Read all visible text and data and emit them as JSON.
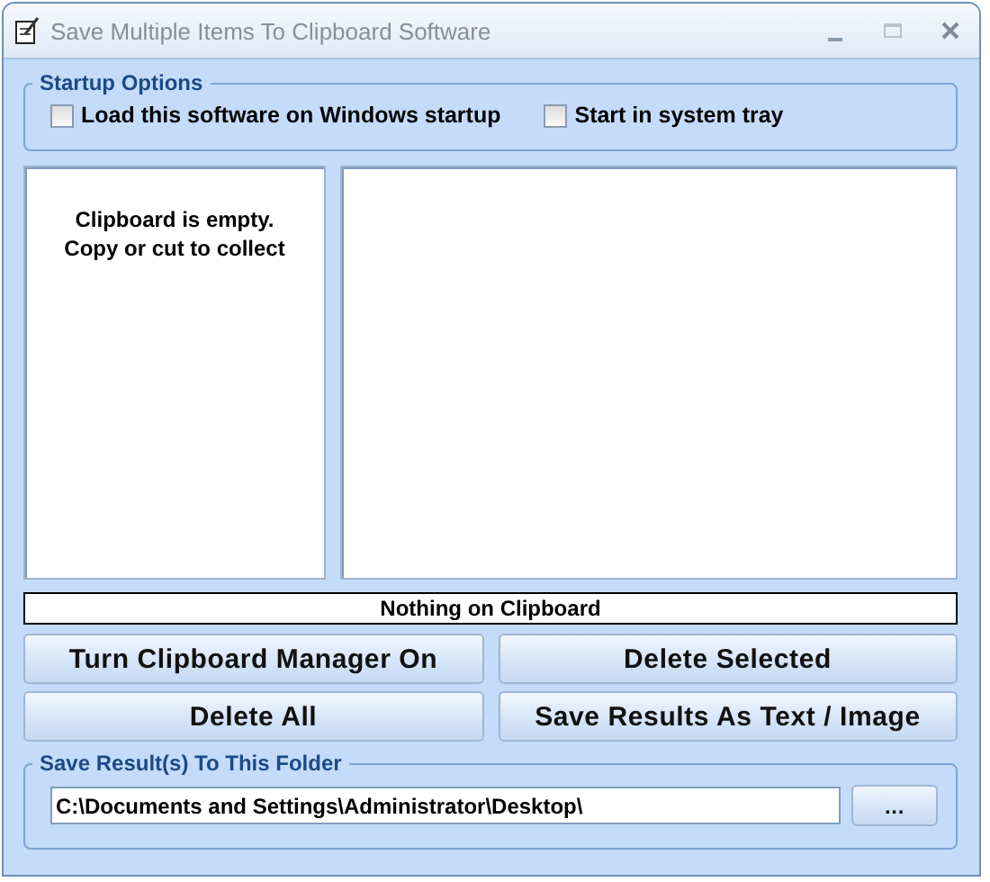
{
  "window": {
    "title": "Save Multiple Items To Clipboard Software"
  },
  "startup_options": {
    "title": "Startup Options",
    "options": [
      {
        "label": "Load this software on Windows startup",
        "checked": false
      },
      {
        "label": "Start in system tray",
        "checked": false
      }
    ]
  },
  "clipboard_list": {
    "empty_message": "Clipboard is empty.\nCopy or cut to collect"
  },
  "status": "Nothing on Clipboard",
  "buttons": [
    "Turn Clipboard Manager On",
    "Delete Selected",
    "Delete All",
    "Save Results As Text / Image"
  ],
  "folder": {
    "title": "Save Result(s) To This Folder",
    "value": "C:\\Documents and Settings\\Administrator\\Desktop\\",
    "browse": "..."
  }
}
